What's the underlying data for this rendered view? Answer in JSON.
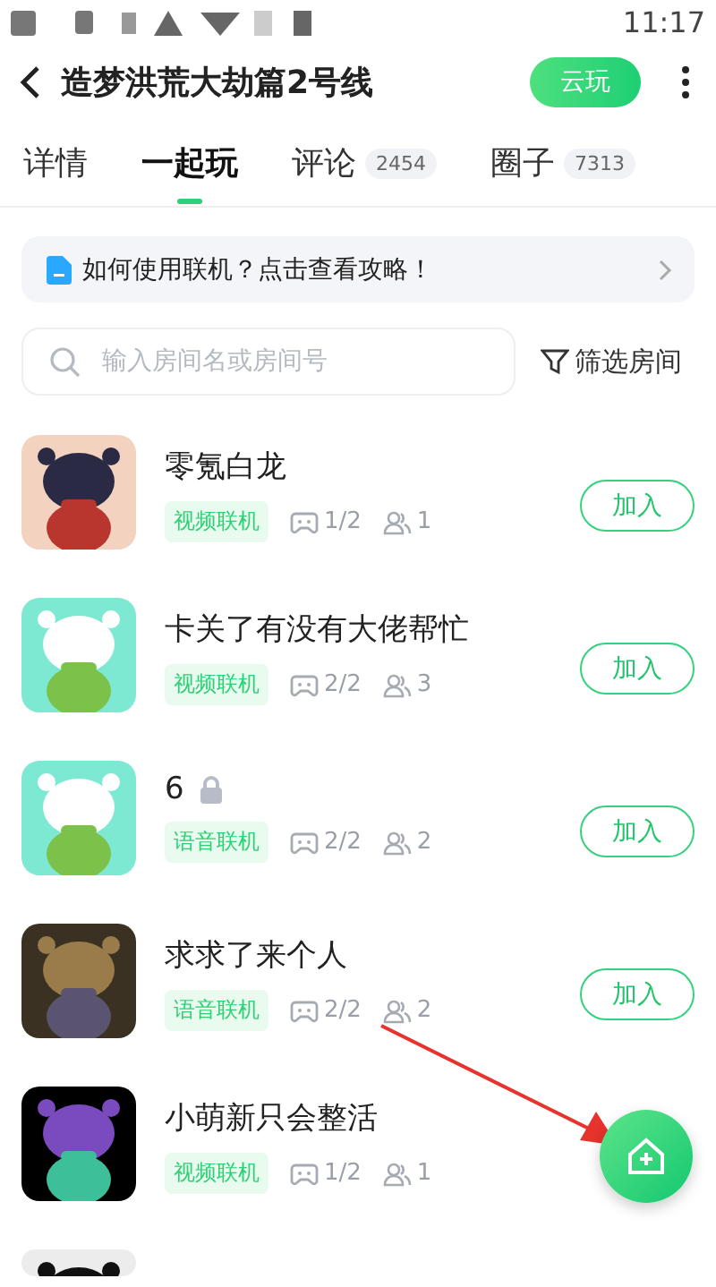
{
  "status_bar": {
    "time": "11:17"
  },
  "header": {
    "title": "造梦洪荒大劫篇2号线",
    "cloud_button": "云玩"
  },
  "tabs": [
    {
      "label": "详情",
      "selected": false
    },
    {
      "label": "一起玩",
      "selected": true
    },
    {
      "label": "评论",
      "badge": "2454",
      "selected": false
    },
    {
      "label": "圈子",
      "badge": "7313",
      "selected": false
    }
  ],
  "guide": {
    "text": "如何使用联机？点击查看攻略！"
  },
  "search": {
    "placeholder": "输入房间名或房间号"
  },
  "filter": "筛选房间",
  "rooms": [
    {
      "name": "零氪白龙",
      "locked": false,
      "tag": "视频联机",
      "slots": "1/2",
      "members": "1",
      "join": "加入",
      "avatar": {
        "kind": "picture"
      }
    },
    {
      "name": "卡关了有没有大佬帮忙",
      "locked": false,
      "tag": "视频联机",
      "slots": "2/2",
      "members": "3",
      "join": "加入",
      "avatar": {
        "kind": "picture"
      }
    },
    {
      "name": "6",
      "locked": true,
      "tag": "语音联机",
      "slots": "2/2",
      "members": "2",
      "join": "加入",
      "avatar": {
        "kind": "picture"
      }
    },
    {
      "name": "求求了来个人",
      "locked": false,
      "tag": "语音联机",
      "slots": "2/2",
      "members": "2",
      "join": "加入",
      "avatar": {
        "kind": "picture"
      }
    },
    {
      "name": "小萌新只会整活",
      "locked": false,
      "tag": "视频联机",
      "slots": "1/2",
      "members": "1",
      "avatar": {
        "kind": "picture"
      }
    },
    {
      "avatar": {
        "kind": "picture"
      }
    }
  ]
}
